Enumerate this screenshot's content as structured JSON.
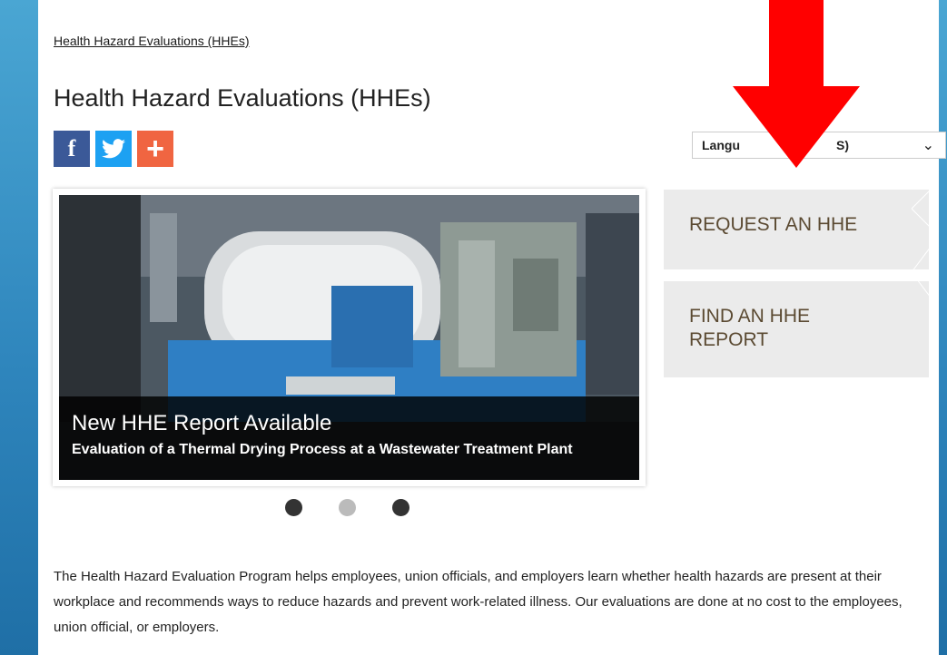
{
  "breadcrumb": "Health Hazard Evaluations (HHEs)",
  "page_title": "Health Hazard Evaluations (HHEs)",
  "social": {
    "facebook_label": "f",
    "plus_label": "+"
  },
  "language_select": {
    "selected_visible": "Langu",
    "selected_tail": "S)"
  },
  "carousel": {
    "slide_title": "New HHE Report Available",
    "slide_subtitle": "Evaluation of a Thermal Drying Process at a Wastewater Treatment Plant",
    "dots": [
      "dark",
      "light",
      "dark"
    ]
  },
  "actions": {
    "request_label": "REQUEST AN HHE",
    "find_label": "FIND AN HHE REPORT"
  },
  "intro_text": "The Health Hazard Evaluation Program helps employees, union officials, and employers learn whether health hazards are present at their workplace and recommends ways to reduce hazards and prevent work-related illness. Our evaluations are done at no cost to the employees, union official, or employers.",
  "colors": {
    "facebook": "#3b5998",
    "twitter": "#1da1f2",
    "share": "#f06541",
    "arrow": "#ff0000",
    "action_text": "#5b4a32",
    "slide_background": "#3d4a55"
  }
}
